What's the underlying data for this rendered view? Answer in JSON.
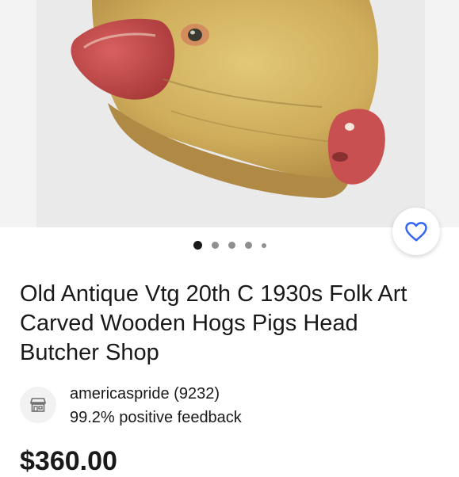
{
  "listing": {
    "title": "Old Antique Vtg 20th C 1930s Folk Art Carved Wooden Hogs Pigs Head Butcher Shop",
    "image_description": "Carved wooden pig head, tan with red ears and snout",
    "gallery_count": 5,
    "gallery_active_index": 0
  },
  "seller": {
    "name": "americaspride (9232)",
    "feedback": "99.2% positive feedback"
  },
  "price": {
    "display": "$360.00"
  },
  "icons": {
    "favorite": "heart-icon",
    "seller": "store-icon"
  },
  "colors": {
    "accent": "#3665f3",
    "text": "#191919",
    "gallery_bg": "#f3f3f3"
  }
}
